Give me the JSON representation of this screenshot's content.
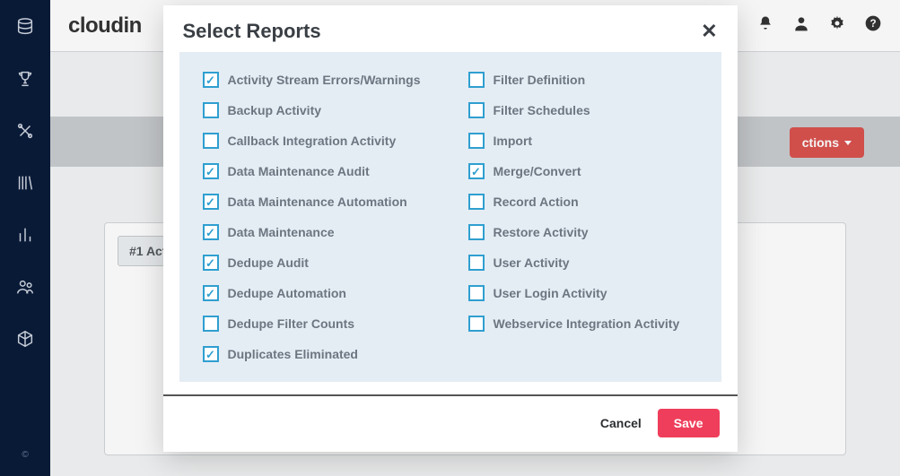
{
  "brand": {
    "text": "cloudin"
  },
  "topbar": {
    "icons": [
      "bell-icon",
      "user-icon",
      "gear-icon",
      "help-icon"
    ]
  },
  "sidebar": {
    "icons": [
      "database-icon",
      "trophy-icon",
      "tools-icon",
      "library-icon",
      "chart-icon",
      "people-icon",
      "cube-icon"
    ],
    "copyright": "©"
  },
  "content": {
    "actions_label": "ctions",
    "panel_tab": "#1 Act"
  },
  "modal": {
    "title": "Select Reports",
    "cancel_label": "Cancel",
    "save_label": "Save",
    "left": [
      {
        "label": "Activity Stream Errors/Warnings",
        "checked": true
      },
      {
        "label": "Backup Activity",
        "checked": false
      },
      {
        "label": "Callback Integration Activity",
        "checked": false
      },
      {
        "label": "Data Maintenance Audit",
        "checked": true
      },
      {
        "label": "Data Maintenance Automation",
        "checked": true
      },
      {
        "label": "Data Maintenance",
        "checked": true
      },
      {
        "label": "Dedupe Audit",
        "checked": true
      },
      {
        "label": "Dedupe Automation",
        "checked": true
      },
      {
        "label": "Dedupe Filter Counts",
        "checked": false
      },
      {
        "label": "Duplicates Eliminated",
        "checked": true
      }
    ],
    "right": [
      {
        "label": "Filter Definition",
        "checked": false
      },
      {
        "label": "Filter Schedules",
        "checked": false
      },
      {
        "label": "Import",
        "checked": false
      },
      {
        "label": "Merge/Convert",
        "checked": true
      },
      {
        "label": "Record Action",
        "checked": false
      },
      {
        "label": "Restore Activity",
        "checked": false
      },
      {
        "label": "User Activity",
        "checked": false
      },
      {
        "label": "User Login Activity",
        "checked": false
      },
      {
        "label": "Webservice Integration Activity",
        "checked": false
      }
    ]
  }
}
